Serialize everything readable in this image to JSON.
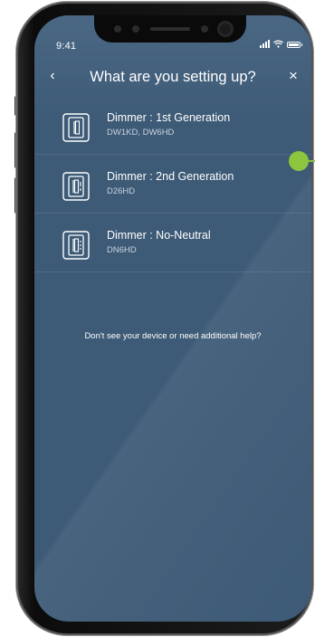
{
  "status_bar": {
    "time": "9:41"
  },
  "header": {
    "title": "What are you setting up?",
    "back_icon": "chevron-left-icon",
    "back_glyph": "‹",
    "close_icon": "close-icon",
    "close_glyph": "×"
  },
  "devices": [
    {
      "name": "Dimmer : 1st Generation",
      "models": "DW1KD, DW6HD",
      "icon": "dimmer-switch-icon"
    },
    {
      "name": "Dimmer : 2nd Generation",
      "models": "D26HD",
      "icon": "dimmer-switch-icon"
    },
    {
      "name": "Dimmer : No-Neutral",
      "models": "DN6HD",
      "icon": "dimmer-switch-icon"
    }
  ],
  "help": {
    "text": "Don't see your device or need additional help?"
  },
  "colors": {
    "background": "#3d5a76",
    "text": "#ffffff",
    "subtext": "#c9d4df",
    "callout": "#8cc63f"
  }
}
